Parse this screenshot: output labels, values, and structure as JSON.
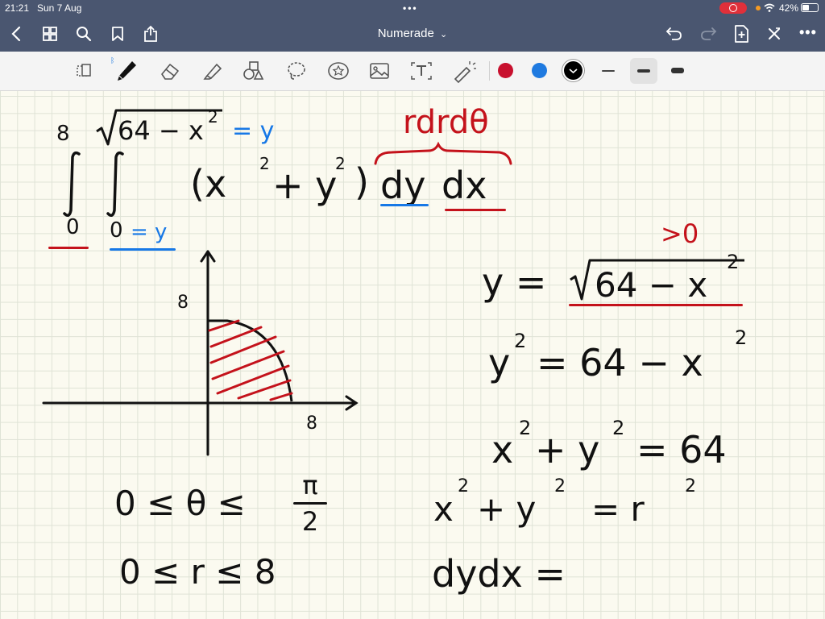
{
  "status": {
    "time": "21:21",
    "date": "Sun 7 Aug",
    "battery": "42%"
  },
  "nav": {
    "title": "Numerade",
    "dropdown_glyph": "⌄"
  },
  "toolbar": {
    "tools": [
      "lasso-select-icon",
      "pen-icon",
      "eraser-icon",
      "highlighter-icon",
      "shapes-icon",
      "lasso-icon",
      "sticker-icon",
      "image-icon",
      "text-icon",
      "laser-pointer-icon"
    ],
    "colors": [
      "#c8102e",
      "#1f7ae0",
      "#000000"
    ],
    "selected_color": "#000000"
  },
  "note": {
    "integral": {
      "outer_upper": "8",
      "outer_lower": "0",
      "inner_upper_root": "64 − x",
      "inner_upper_exp": "2",
      "inner_upper_eq": "= y",
      "inner_lower": "0",
      "inner_lower_eq": "= y",
      "integrand_open": "(x",
      "integrand_exp1": "2",
      "integrand_plus": "+ y",
      "integrand_exp2": "2",
      "integrand_close": ")",
      "differential_dy": "dy",
      "differential_dx": "dx",
      "polar_differential": "rdrdθ"
    },
    "graph": {
      "y_tick": "8",
      "x_tick": "8"
    },
    "bounds": {
      "theta_lhs": "0 ≤ θ ≤",
      "theta_num": "π",
      "theta_den": "2",
      "r": "0 ≤ r ≤ 8"
    },
    "derivation": {
      "positive_note": ">0",
      "line1_lhs": "y =",
      "line1_root": "64 − x",
      "line1_exp": "2",
      "line2": "y",
      "line2_exp": "2",
      "line2_rhs": "= 64 − x",
      "line2_exp2": "2",
      "line3_a": "x",
      "line3_exp_a": "2",
      "line3_b": "+ y",
      "line3_exp_b": "2",
      "line3_rhs": "= 64",
      "line4_a": "x",
      "line4_exp_a": "2",
      "line4_b": "+ y",
      "line4_exp_b": "2",
      "line4_rhs": "= r",
      "line4_exp_c": "2",
      "line5": "dydx ="
    }
  }
}
